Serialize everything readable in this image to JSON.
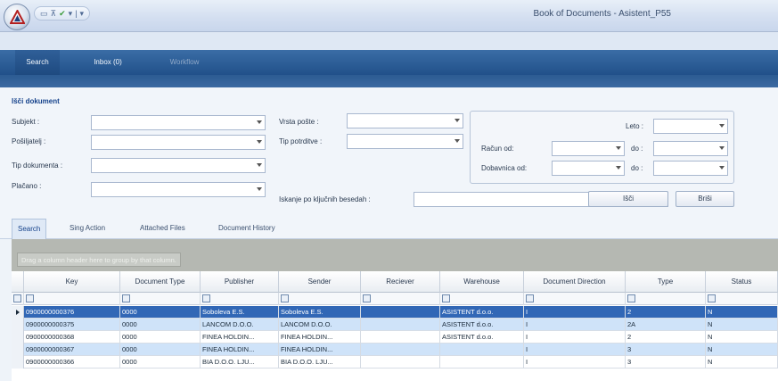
{
  "window": {
    "title": "Book of Documents - Asistent_P55"
  },
  "nav": {
    "tabs": [
      {
        "label": "Search"
      },
      {
        "label": "Inbox (0)"
      },
      {
        "label": "Workflow"
      }
    ]
  },
  "search": {
    "title": "Išči dokument",
    "subjekt_label": "Subjekt :",
    "posiljatelj_label": "Pošiljatelj :",
    "tip_dokumenta_label": "Tip dokumenta :",
    "placano_label": "Plačano :",
    "vrsta_poste_label": "Vrsta pošte :",
    "tip_potrditve_label": "Tip potrditve :",
    "keyword_label": "Iskanje po ključnih besedah :",
    "leto_label": "Leto :",
    "racun_od_label": "Račun od:",
    "dobavnica_od_label": "Dobavnica od:",
    "do_label": "do :",
    "search_button": "Išči",
    "clear_button": "Briši"
  },
  "subtabs": [
    {
      "label": "Search"
    },
    {
      "label": "Sing Action"
    },
    {
      "label": "Attached Files"
    },
    {
      "label": "Document History"
    }
  ],
  "grid": {
    "group_hint": "Drag a column header here to group by that column.",
    "columns": [
      "Key",
      "Document Type",
      "Publisher",
      "Sender",
      "Reciever",
      "Warehouse",
      "Document Direction",
      "Type",
      "Status"
    ],
    "rows": [
      {
        "key": "0900000000376",
        "doctype": "0000",
        "publisher": "Soboleva E.S.",
        "sender": "Soboleva E.S.",
        "reciever": "",
        "warehouse": "ASISTENT d.o.o.",
        "direction": "I",
        "type": "2",
        "status": "N"
      },
      {
        "key": "0900000000375",
        "doctype": "0000",
        "publisher": "LANCOM D.O.O.",
        "sender": "LANCOM D.O.O.",
        "reciever": "",
        "warehouse": "ASISTENT d.o.o.",
        "direction": "I",
        "type": "2A",
        "status": "N"
      },
      {
        "key": "0900000000368",
        "doctype": "0000",
        "publisher": "FINEA HOLDIN...",
        "sender": "FINEA HOLDIN...",
        "reciever": "",
        "warehouse": "ASISTENT d.o.o.",
        "direction": "I",
        "type": "2",
        "status": "N"
      },
      {
        "key": "0900000000367",
        "doctype": "0000",
        "publisher": "FINEA HOLDIN...",
        "sender": "FINEA HOLDIN...",
        "reciever": "",
        "warehouse": "",
        "direction": "I",
        "type": "3",
        "status": "N"
      },
      {
        "key": "0900000000366",
        "doctype": "0000",
        "publisher": "BIA D.O.O. LJU...",
        "sender": "BIA D.O.O. LJU...",
        "reciever": "",
        "warehouse": "",
        "direction": "I",
        "type": "3",
        "status": "N"
      }
    ]
  }
}
